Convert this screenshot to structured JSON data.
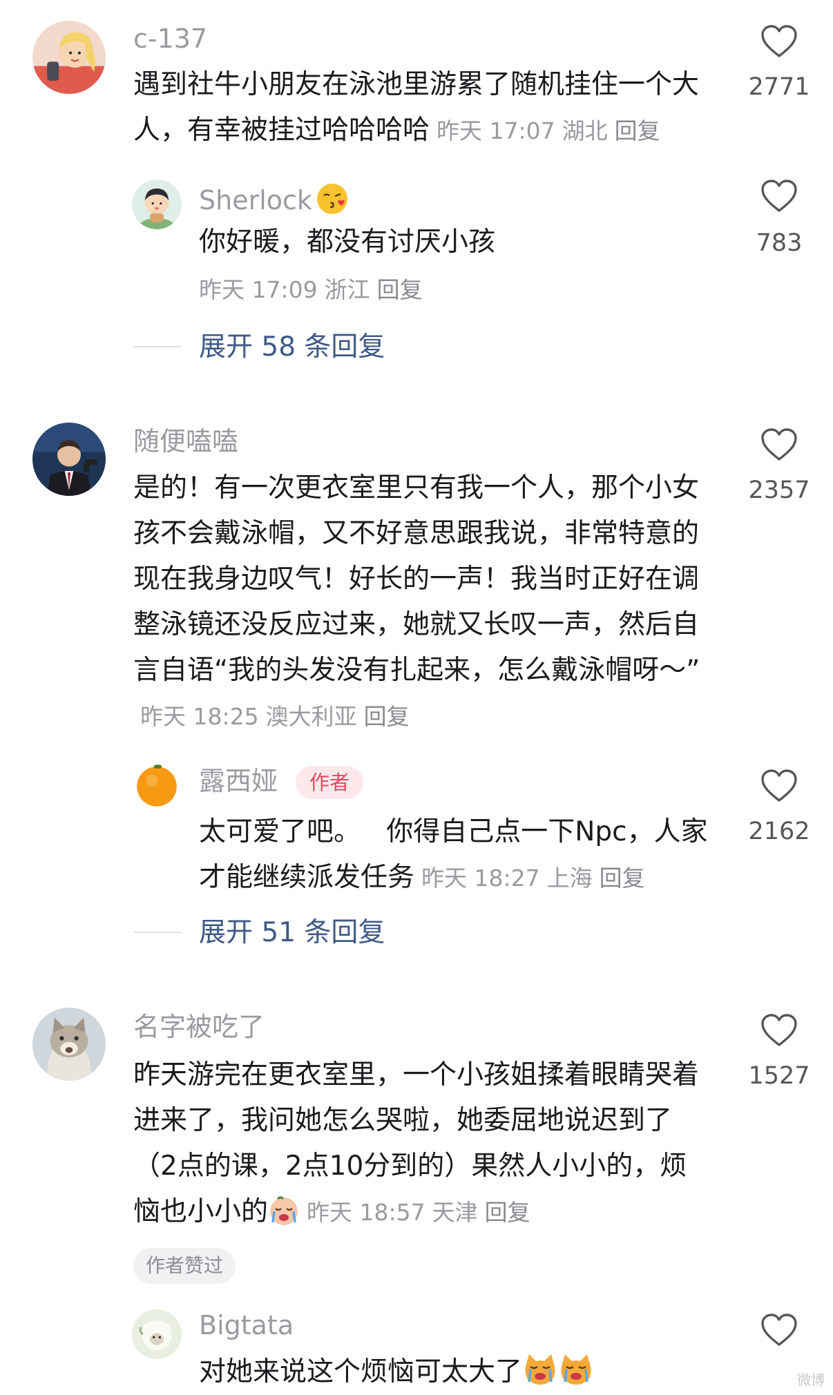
{
  "comments": [
    {
      "username": "c-137",
      "avatar": "cartoon-girl-avatar",
      "text": "遇到社牛小朋友在泳池里游累了随机挂住一个大人，有幸被挂过哈哈哈哈",
      "time": "昨天 17:07",
      "location": "湖北",
      "reply_label": "回复",
      "likes": "2771",
      "reply": {
        "username": "Sherlock",
        "username_emoji": "kissing-face-emoji",
        "avatar": "cartoon-kid-avatar",
        "text": "你好暖，都没有讨厌小孩",
        "time": "昨天 17:09",
        "location": "浙江",
        "reply_label": "回复",
        "likes": "783"
      },
      "expand_label": "展开 58 条回复"
    },
    {
      "username": "随便嗑嗑",
      "avatar": "man-in-suit-avatar",
      "text": "是的！有一次更衣室里只有我一个人，那个小女孩不会戴泳帽，又不好意思跟我说，非常特意的现在我身边叹气！好长的一声！我当时正好在调整泳镜还没反应过来，她就又长叹一声，然后自言自语“我的头发没有扎起来，怎么戴泳帽呀～”",
      "time": "昨天 18:25",
      "location": "澳大利亚",
      "reply_label": "回复",
      "likes": "2357",
      "reply": {
        "username": "露西娅",
        "author_badge": "作者",
        "avatar": "orange-avatar",
        "text": "太可爱了吧。   你得自己点一下Npc，人家才能继续派发任务",
        "time": "昨天 18:27",
        "location": "上海",
        "reply_label": "回复",
        "likes": "2162"
      },
      "expand_label": "展开 51 条回复"
    },
    {
      "username": "名字被吃了",
      "avatar": "cat-avatar",
      "text": "昨天游完在更衣室里，一个小孩姐揉着眼睛哭着进来了，我问她怎么哭啦，她委屈地说迟到了（2点的课，2点10分到的）果然人小小的，烦恼也小小的",
      "text_emoji": "crying-face-emoji",
      "time": "昨天 18:57",
      "location": "天津",
      "reply_label": "回复",
      "likes": "1527",
      "liked_by_author": "作者赞过",
      "reply": {
        "username": "Bigtata",
        "avatar": "sheep-avatar",
        "text": "对她来说这个烦恼可太大了",
        "text_emoji": "crying-cat-face-emoji"
      }
    }
  ],
  "watermark": "微博"
}
